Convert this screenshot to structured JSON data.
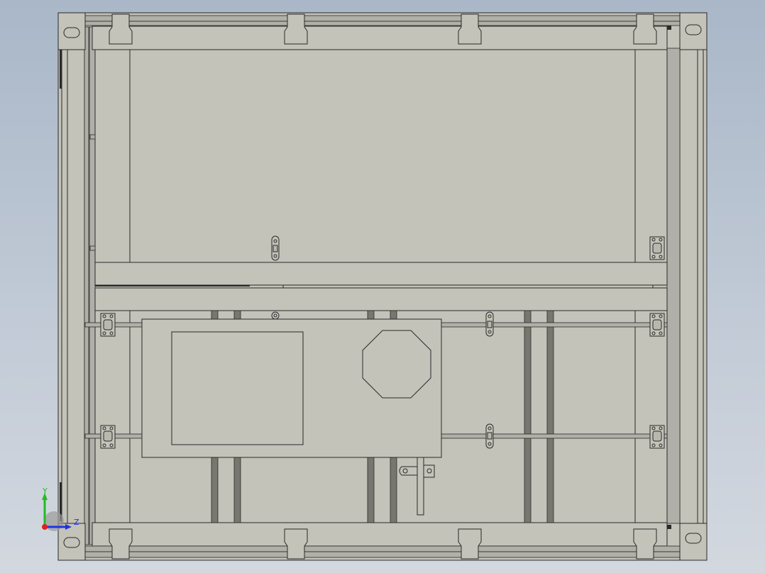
{
  "view": {
    "type": "cad-graphics-area",
    "model_colors": {
      "face": "#c3c3b9",
      "face_dark": "#b4b4aa",
      "edge": "#2a2a2a",
      "rail": "#a8a8a0",
      "slot": "#6f6f68"
    }
  },
  "triad": {
    "y_label": "Y",
    "z_label": "Z",
    "y_color": "#22bb22",
    "z_color": "#2233dd",
    "x_color": "#dd2222"
  }
}
